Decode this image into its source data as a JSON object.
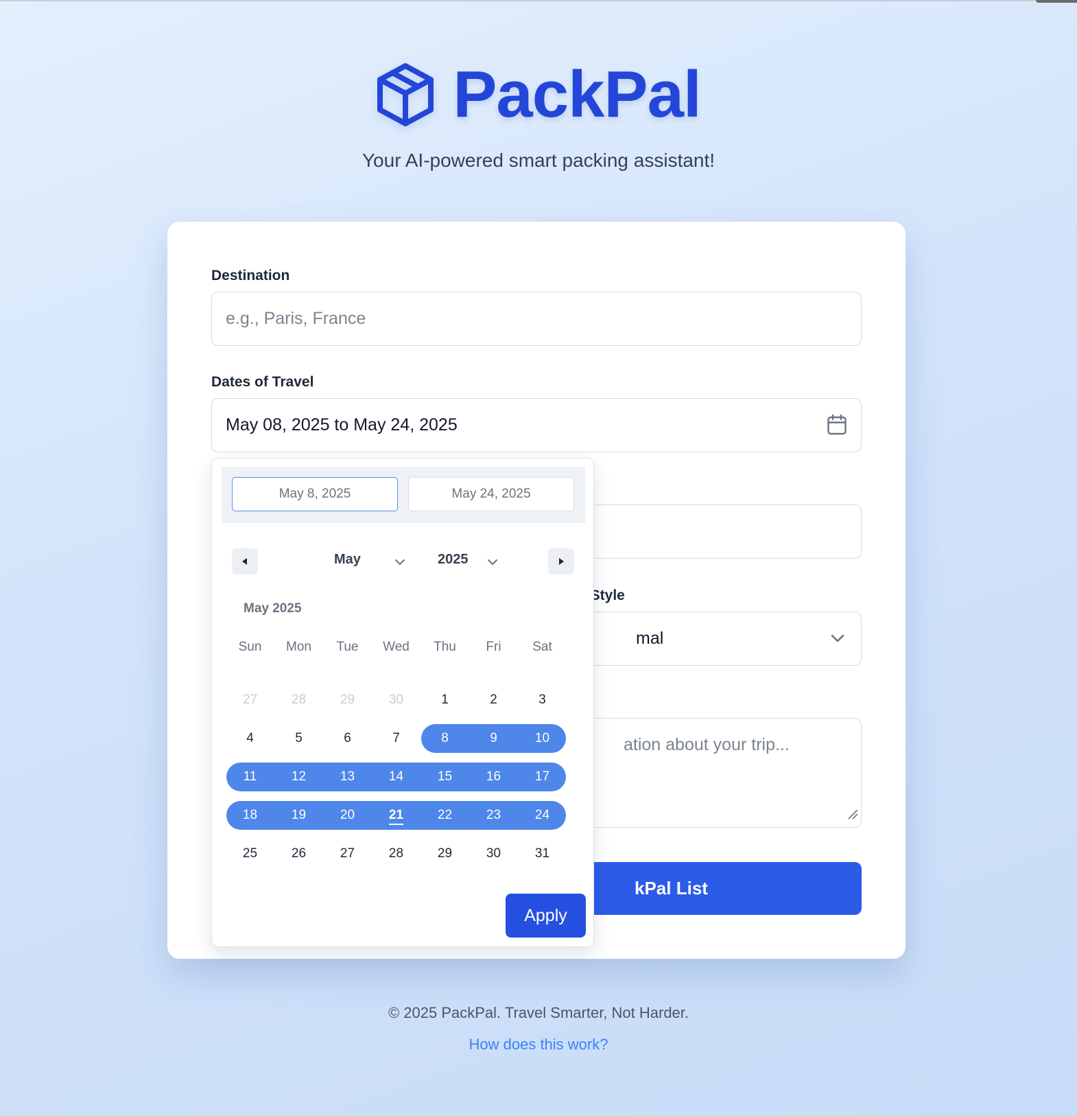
{
  "header": {
    "brand_name": "PackPal",
    "brand_icon": "package-box-icon",
    "tagline": "Your AI-powered smart packing assistant!"
  },
  "form": {
    "destination": {
      "label": "Destination",
      "placeholder": "e.g., Paris, France"
    },
    "dates": {
      "label": "Dates of Travel",
      "value": "May 08, 2025 to May 24, 2025",
      "icon": "calendar-icon"
    },
    "style": {
      "label_visible": "g Style",
      "value_visible": "mal",
      "icon": "chevron-down-icon"
    },
    "notes": {
      "placeholder_visible": "ation about your trip..."
    },
    "submit": {
      "label_visible": "kPal List"
    }
  },
  "date_picker": {
    "start_input": "May 8, 2025",
    "end_input": "May 24, 2025",
    "month": "May",
    "year": "2025",
    "caption": "May 2025",
    "weekdays": [
      "Sun",
      "Mon",
      "Tue",
      "Wed",
      "Thu",
      "Fri",
      "Sat"
    ],
    "weeks": [
      [
        "27",
        "28",
        "29",
        "30",
        "1",
        "2",
        "3"
      ],
      [
        "4",
        "5",
        "6",
        "7",
        "8",
        "9",
        "10"
      ],
      [
        "11",
        "12",
        "13",
        "14",
        "15",
        "16",
        "17"
      ],
      [
        "18",
        "19",
        "20",
        "21",
        "22",
        "23",
        "24"
      ],
      [
        "25",
        "26",
        "27",
        "28",
        "29",
        "30",
        "31"
      ]
    ],
    "outside_month_days": [
      "27",
      "28",
      "29",
      "30"
    ],
    "selected_range": {
      "start": "8",
      "end": "24"
    },
    "today": "21",
    "apply_label": "Apply",
    "prev_icon": "caret-left-icon",
    "next_icon": "caret-right-icon"
  },
  "footer": {
    "copyright": "© 2025 PackPal. Travel Smarter, Not Harder.",
    "help_link": "How does this work?"
  },
  "colors": {
    "brand": "#2346d8",
    "primary_button": "#2c5be8",
    "range_highlight": "#4e86ea",
    "link": "#3b82f6"
  }
}
